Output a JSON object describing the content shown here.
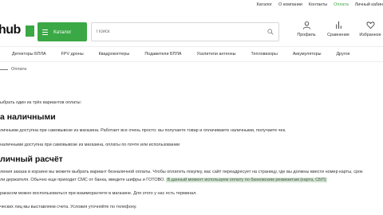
{
  "topnav": {
    "links": [
      "Каталог",
      "О компании",
      "Контакты",
      "Оплата",
      "Личный кабин"
    ],
    "active_index": 3
  },
  "header": {
    "logo_text": "hub",
    "catalog_label": "Каталог",
    "search_placeholder": "Поиск",
    "actions": {
      "profile": "Профиль",
      "compare": "Сравнение",
      "favorites": "Избранное"
    }
  },
  "menu": {
    "items": [
      "Детекторы БПЛА",
      "FPV дроны",
      "Квадрокоптеры",
      "Подавители БПЛА",
      "Усилители антенны",
      "Тепловизоры",
      "Аккумуляторы",
      "Другое"
    ]
  },
  "breadcrumb": {
    "current": "Оплата"
  },
  "content": {
    "intro": "ыбрать один из трёх вариантов оплаты:",
    "heading_cash": "а наличными",
    "cash_text_1": "личными доступна при самовывозе из магазина. Работает все очень просто: вы получаете товар и оплачиваете наличными, получаете чек.",
    "cash_text_2": "наличными доступна при самовывозе из магазина, оплаты по почте или использовании",
    "heading_noncash": "личный расчёт",
    "noncash_text_1": "ления заказа в корзине вы можете выбрать вариант безналичной оплаты. Чтобы оплатить покупку, вас сайт переадресует на страницу, где вы должны ввести номер карты, срок",
    "noncash_text_2_a": "ли держателя. Обычно еще приходит СМС от банка, введите шифры и ГОТОВО.",
    "noncash_text_2_highlight": "В данный момент используем оплату по банковским реквизитам (карта, СБП)",
    "noncash_text_3": "ракасом можно воспользоваться при взаиморасчете в магазине. Для этого у нас есть терминал.",
    "noncash_text_4": "ческих лиц мы выставляем счета. Условия уточняйте по телефону."
  },
  "colors": {
    "accent": "#3aa845",
    "highlight": "#cfe5cf"
  }
}
